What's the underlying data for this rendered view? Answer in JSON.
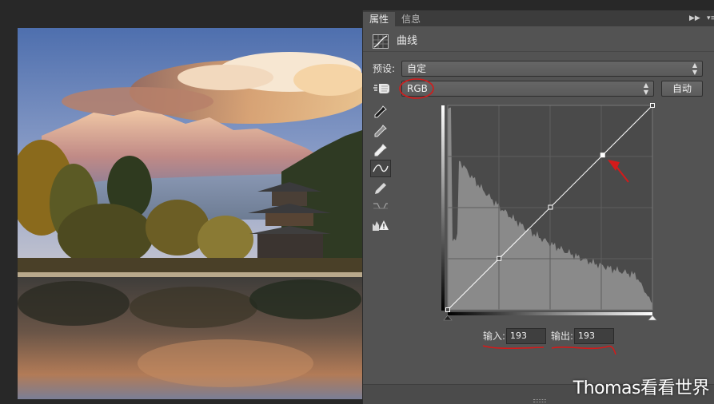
{
  "panel": {
    "tabs": [
      {
        "label": "属性",
        "active": true
      },
      {
        "label": "信息",
        "active": false
      }
    ],
    "title": "曲线",
    "preset_label": "预设:",
    "preset_value": "自定",
    "channel_value": "RGB",
    "auto_button": "自动",
    "input_label": "输入:",
    "input_value": "193",
    "output_label": "输出:",
    "output_value": "193"
  },
  "curve": {
    "points": [
      [
        0,
        0
      ],
      [
        64,
        64
      ],
      [
        128,
        128
      ],
      [
        193,
        193
      ],
      [
        255,
        255
      ]
    ],
    "histogram_shape": "high shadows, declining toward highlights"
  },
  "icons": {
    "curves": "curves-adjustment-icon",
    "hand": "on-image-adjust-hand-icon",
    "eyedroppers": [
      "black-point-eyedropper-icon",
      "gray-point-eyedropper-icon",
      "white-point-eyedropper-icon"
    ],
    "curve_tool": "curve-edit-icon",
    "pencil": "pencil-draw-icon",
    "smooth": "smooth-curve-icon",
    "clip_warning": "clipping-warning-icon"
  },
  "colors": {
    "annotation_red": "#d41a1a",
    "panel_bg": "#535353"
  },
  "watermark": "Thomas看看世界"
}
